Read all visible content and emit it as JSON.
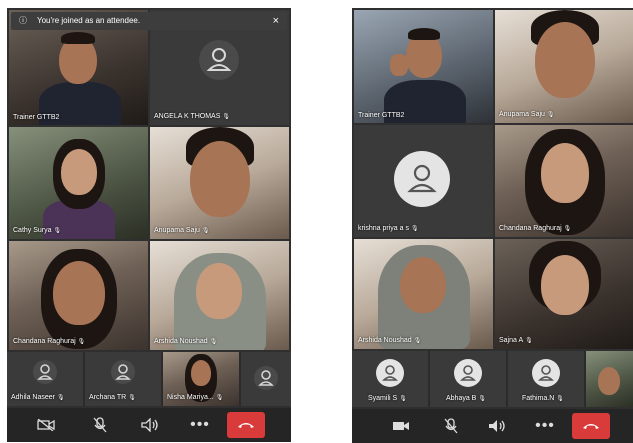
{
  "left": {
    "banner": {
      "text": "You're joined as an attendee.",
      "info_icon": "ⓘ",
      "close": "×"
    },
    "tiles": [
      {
        "label": "Trainer GTTB2"
      },
      {
        "label": "ANGELA K THOMAS"
      },
      {
        "label": "Cathy Surya"
      },
      {
        "label": "Anupama Saju"
      },
      {
        "label": "Chandana Raghuraj"
      },
      {
        "label": "Arshida Noushad"
      }
    ],
    "strip": [
      {
        "label": "Adhila Naseer"
      },
      {
        "label": "Archana TR"
      },
      {
        "label": "Nisha Mariya..."
      }
    ]
  },
  "right": {
    "tiles": [
      {
        "label": "Trainer GTTB2"
      },
      {
        "label": "Anupama Saju"
      },
      {
        "label": "krishna priya a s"
      },
      {
        "label": "Chandana Raghuraj"
      },
      {
        "label": "Arshida Noushad"
      },
      {
        "label": "Sajna A"
      }
    ],
    "strip": [
      {
        "label": "Syamili S"
      },
      {
        "label": "Abhaya B"
      },
      {
        "label": "Fathima.N"
      }
    ]
  },
  "controls": {
    "camera_off": "camera-off-icon",
    "mic_off": "mic-off-icon",
    "speaker": "speaker-icon",
    "more": "more-icon",
    "hangup": "hangup-icon",
    "hangup_color": "#d93a3a"
  },
  "muted_glyph": "🎙"
}
